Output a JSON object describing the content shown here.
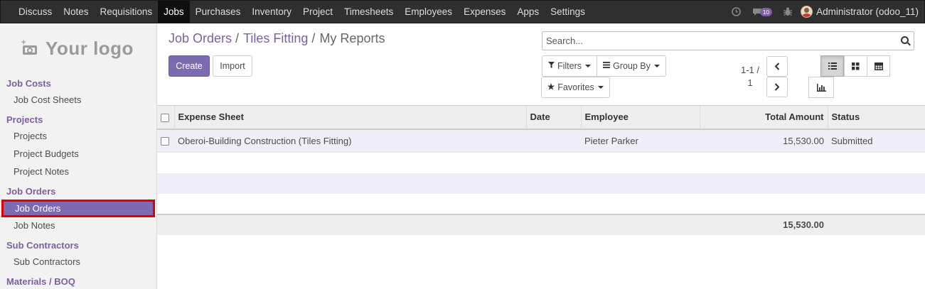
{
  "topbar": {
    "menu": [
      "Discuss",
      "Notes",
      "Requisitions",
      "Jobs",
      "Purchases",
      "Inventory",
      "Project",
      "Timesheets",
      "Employees",
      "Expenses",
      "Apps",
      "Settings"
    ],
    "active": "Jobs",
    "messages_badge": "10",
    "user_name": "Administrator (odoo_11)"
  },
  "sidebar": {
    "logo_text": "Your logo",
    "sections": [
      {
        "title": "Job Costs",
        "items": [
          "Job Cost Sheets"
        ]
      },
      {
        "title": "Projects",
        "items": [
          "Projects",
          "Project Budgets",
          "Project Notes"
        ]
      },
      {
        "title": "Job Orders",
        "items": [
          "Job Orders",
          "Job Notes"
        ]
      },
      {
        "title": "Sub Contractors",
        "items": [
          "Sub Contractors"
        ]
      },
      {
        "title": "Materials / BOQ",
        "items": []
      }
    ],
    "active_item": "Job Orders"
  },
  "breadcrumb": {
    "items": [
      "Job Orders",
      "Tiles Fitting"
    ],
    "current": "My Reports"
  },
  "buttons": {
    "create": "Create",
    "import": "Import",
    "filters": "Filters",
    "group_by": "Group By",
    "favorites": "Favorites"
  },
  "search": {
    "placeholder": "Search..."
  },
  "pager": {
    "line1": "1-1 /",
    "line2": "1"
  },
  "table": {
    "headers": [
      "Expense Sheet",
      "Date",
      "Employee",
      "Total Amount",
      "Status"
    ],
    "rows": [
      {
        "expense_sheet": "Oberoi-Building Construction (Tiles Fitting)",
        "date": "",
        "employee": "Pieter Parker",
        "total_amount": "15,530.00",
        "status": "Submitted"
      }
    ],
    "footer_total": "15,530.00"
  },
  "colors": {
    "accent": "#7c5fa0",
    "navbar": "#2f2f2f",
    "highlight_border": "#e00000"
  }
}
